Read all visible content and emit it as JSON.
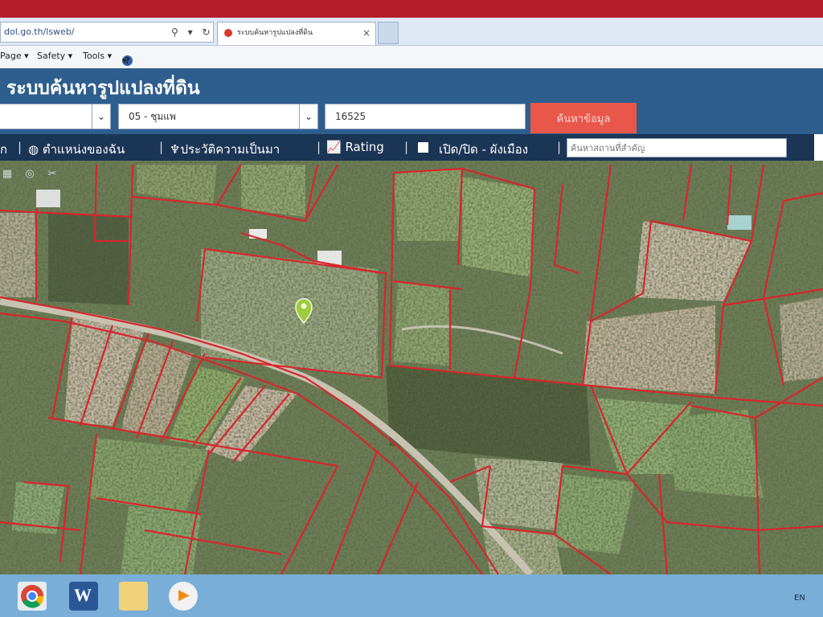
{
  "browser": {
    "address": "dol.go.th/lsweb/",
    "address_icons": "⚲ ▾ ↻",
    "tab_title": "ระบบค้นหารูปแปลงที่ดิน",
    "tab_close": "×",
    "menu": [
      "Page ▾",
      "Safety ▾",
      "Tools ▾",
      "▾"
    ],
    "help_icon": "?"
  },
  "header": {
    "title": "ระบบค้นหารูปแปลงที่ดิน",
    "select1_value": "",
    "select2_value": "05 - ชุมแพ",
    "parcel_input_value": "16525",
    "search_button_label": "ค้นหาข้อมูล"
  },
  "toolbar": {
    "home_partial": "ก",
    "my_location": "ตำแหน่งของฉัน",
    "history": "ประวัติความเป็นมา",
    "rating": "Rating",
    "toggle_cityplan": "เปิด/ปิด - ผังเมือง",
    "place_search_placeholder": "ค้นหาสถานที่สำคัญ"
  },
  "map": {
    "parcel_line_color": "#d8262e",
    "marker_color": "#9ccb3b"
  },
  "taskbar": {
    "language": "EN",
    "apps": [
      "chrome-icon",
      "word-icon",
      "file-explorer-icon",
      "media-player-icon"
    ]
  }
}
